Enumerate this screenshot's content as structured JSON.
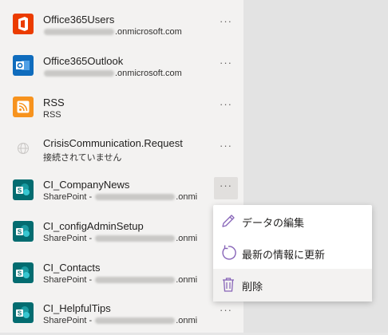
{
  "connections": [
    {
      "title": "Office365Users",
      "sub_prefix": "",
      "sub_suffix": ".onmicrosoft.com",
      "icon": "office-icon",
      "color": "#eb3c00",
      "has_blur": true
    },
    {
      "title": "Office365Outlook",
      "sub_prefix": "",
      "sub_suffix": ".onmicrosoft.com",
      "icon": "outlook-icon",
      "color": "#0f6cbd",
      "has_blur": true
    },
    {
      "title": "RSS",
      "sub_prefix": "RSS",
      "sub_suffix": "",
      "icon": "rss-icon",
      "color": "#f7931e",
      "has_blur": false
    },
    {
      "title": "CrisisCommunication.Request",
      "sub_prefix": "接続されていません",
      "sub_suffix": "",
      "icon": "globe-icon",
      "color": "#ffffff",
      "has_blur": false
    },
    {
      "title": "CI_CompanyNews",
      "sub_prefix": "SharePoint - ",
      "sub_suffix": ".onmi",
      "icon": "sharepoint-icon",
      "color": "#036c70",
      "has_blur": true
    },
    {
      "title": "CI_configAdminSetup",
      "sub_prefix": "SharePoint - ",
      "sub_suffix": ".onmi",
      "icon": "sharepoint-icon",
      "color": "#036c70",
      "has_blur": true
    },
    {
      "title": "CI_Contacts",
      "sub_prefix": "SharePoint - ",
      "sub_suffix": ".onmi",
      "icon": "sharepoint-icon",
      "color": "#036c70",
      "has_blur": true
    },
    {
      "title": "CI_HelpfulTips",
      "sub_prefix": "SharePoint - ",
      "sub_suffix": ".onmi",
      "icon": "sharepoint-icon",
      "color": "#036c70",
      "has_blur": true
    }
  ],
  "more_label": "···",
  "context_menu": {
    "edit_label": "データの編集",
    "refresh_label": "最新の情報に更新",
    "delete_label": "削除"
  },
  "colors": {
    "accent": "#8764b8",
    "panel": "#f3f2f1",
    "sharepoint": "#036c70"
  }
}
